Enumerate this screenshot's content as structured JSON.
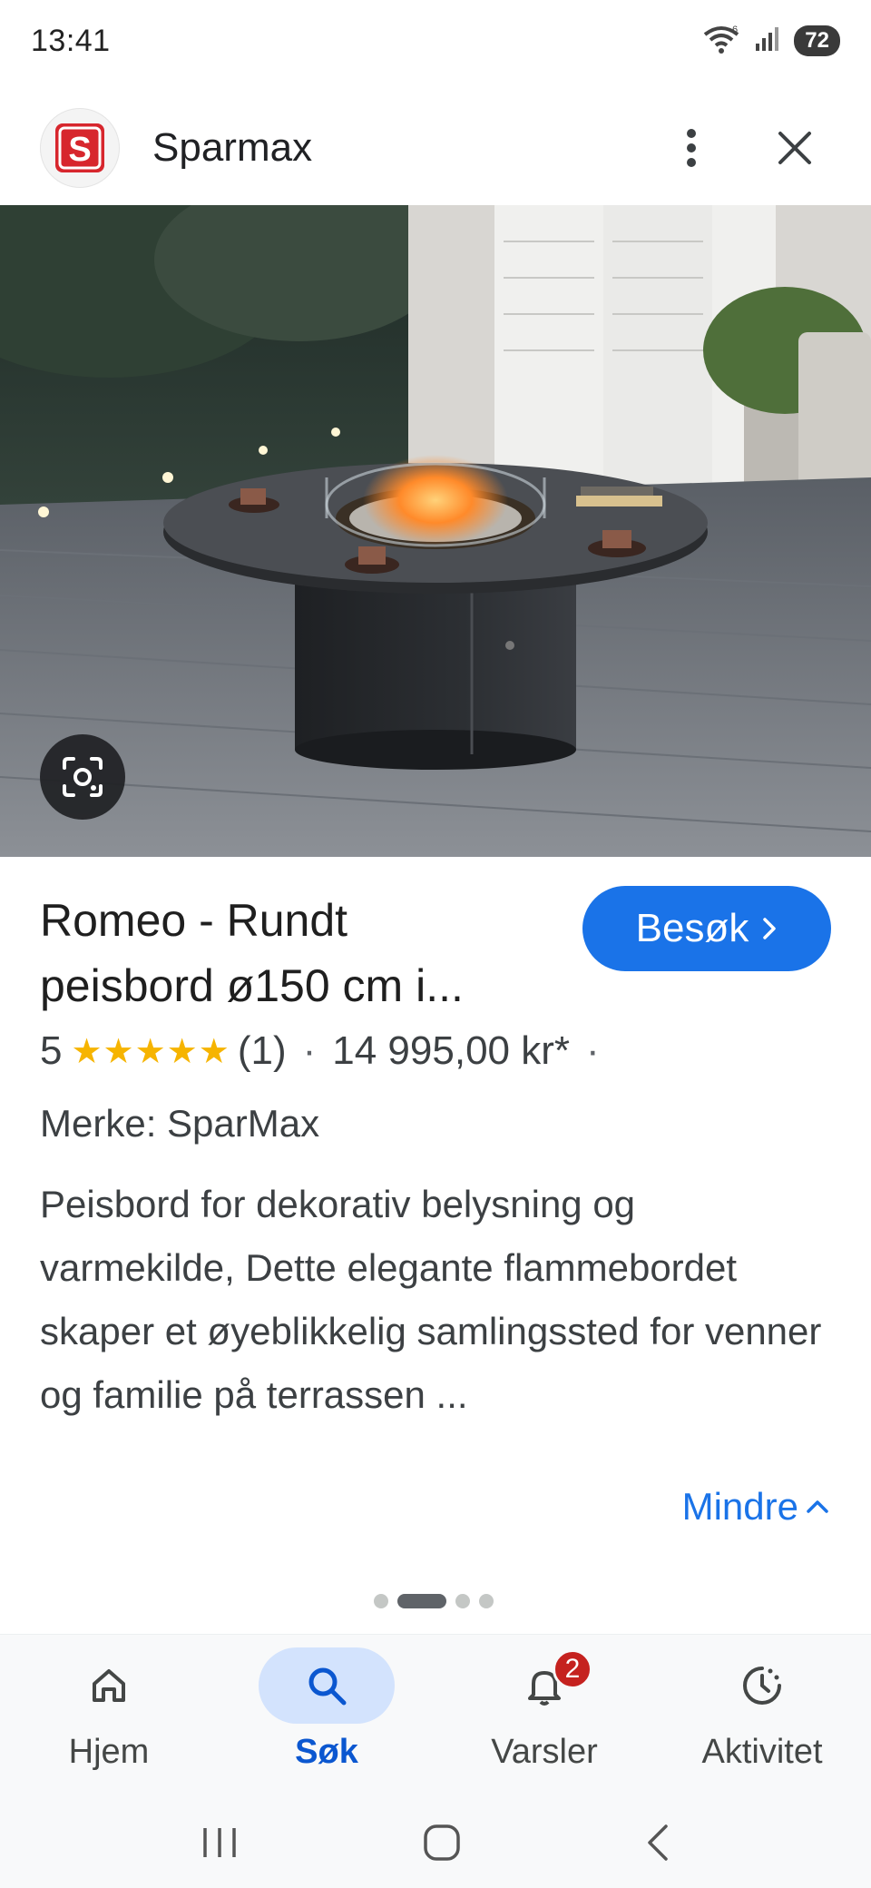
{
  "status_bar": {
    "time": "13:41",
    "battery": "72",
    "wifi_label": "6"
  },
  "header": {
    "site_name": "Sparmax",
    "logo_letter": "S"
  },
  "product": {
    "title_line1": "Romeo - Rundt",
    "title_line2": "peisbord ø150 cm i...",
    "visit_label": "Besøk",
    "rating_value": "5",
    "rating_count": "(1)",
    "price": "14 995,00 kr*",
    "brand": "Merke: SparMax",
    "description": "Peisbord for dekorativ belysning og varmekilde, Dette elegante flammebordet skaper et øyeblikkelig samlingssted for venner og familie på terrassen ...",
    "less_label": "Mindre"
  },
  "pager": {
    "count": 4,
    "active": 1
  },
  "bottom_nav": {
    "items": [
      {
        "label": "Hjem",
        "icon": "home-icon"
      },
      {
        "label": "Søk",
        "icon": "search-icon",
        "active": true
      },
      {
        "label": "Varsler",
        "icon": "bell-icon",
        "badge": "2"
      },
      {
        "label": "Aktivitet",
        "icon": "activity-icon"
      }
    ]
  },
  "colors": {
    "accent": "#1a73e8",
    "star": "#f6b400",
    "badge": "#c5221f",
    "active_pill": "#d3e3fd"
  }
}
